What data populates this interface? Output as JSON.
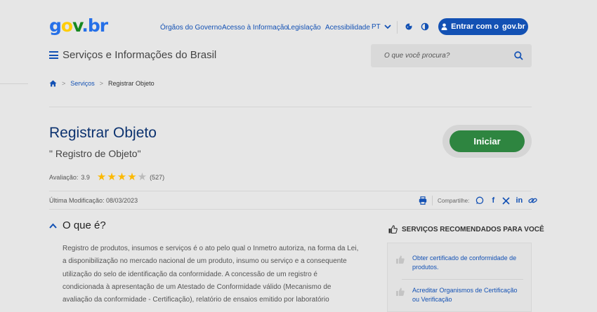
{
  "header": {
    "logo": {
      "g": "g",
      "o1": "o",
      "v": "v",
      "dot": ".",
      "b": "b",
      "r": "r"
    },
    "links": [
      "Órgãos do Governo",
      "Acesso à Informação",
      "Legislação",
      "Acessibilidade"
    ],
    "language": "PT",
    "login_label": "Entrar com o",
    "login_brand": "gov.br",
    "site_title": "Serviços e Informações do Brasil",
    "search_placeholder": "O que você procura?"
  },
  "breadcrumb": {
    "items": [
      "Serviços",
      "Registrar Objeto"
    ]
  },
  "service": {
    "title": "Registrar Objeto",
    "subtitle": "\" Registro de Objeto\"",
    "rating_label": "Avaliação:",
    "rating_value": "3.9",
    "stars_filled": 4,
    "stars_total": 5,
    "rating_count": "(527)",
    "start_label": "Iniciar",
    "last_modified": "Última Modificação: 08/03/2023",
    "share_label": "Compartilhe:"
  },
  "section": {
    "title": "O que é?",
    "lines": [
      "Registro de produtos, insumos e serviços é o ato pelo qual o Inmetro autoriza, na forma da Lei,",
      "a disponibilização no mercado nacional de um produto, insumo ou serviço e a consequente",
      "utilização do selo de identificação da conformidade. A concessão de um registro é",
      "condicionada à apresentação de um Atestado de Conformidade válido (Mecanismo de",
      "avaliação da conformidade - Certificação), relatório de ensaios emitido por laboratório"
    ]
  },
  "recommended": {
    "title": "SERVIÇOS RECOMENDADOS PARA VOCÊ",
    "items": [
      {
        "line1": "Obter certificado de conformidade de",
        "line2": "produtos."
      },
      {
        "line1": "Acreditar Organismos de Certificação",
        "line2": "ou Verificação"
      }
    ]
  },
  "colors": {
    "primary": "#1351b4",
    "success": "#2e8540",
    "title": "#0c326f",
    "star": "#fcb900"
  }
}
